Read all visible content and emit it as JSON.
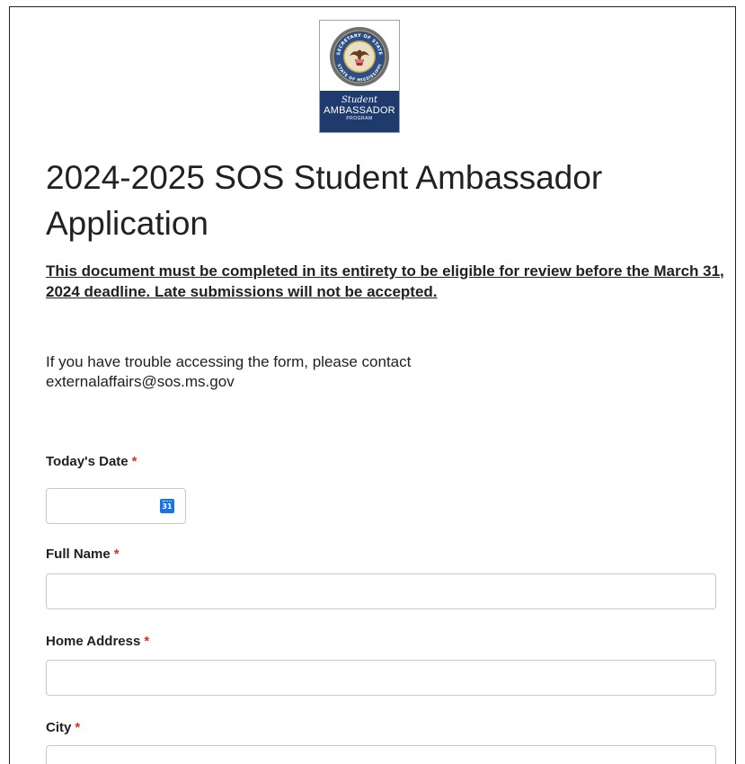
{
  "logo": {
    "banner_line1": "Student",
    "banner_line2": "AMBASSADOR",
    "banner_line3": "PROGRAM",
    "seal_text_top": "SECRETARY OF STATE",
    "seal_text_bottom": "STATE OF MISSISSIPPI"
  },
  "form": {
    "title": "2024-2025 SOS Student Ambassador Application",
    "notice": "This document must be completed in its entirety to be eligible for review before the March 31, 2024 deadline. Late submissions will not be accepted.",
    "contact_line1": "If you have trouble accessing the form, please contact",
    "contact_line2": "externalaffairs@sos.ms.gov",
    "required_marker": "*"
  },
  "fields": {
    "todays_date": {
      "label": "Today's Date",
      "value": ""
    },
    "full_name": {
      "label": "Full Name",
      "value": ""
    },
    "home_address": {
      "label": "Home Address",
      "value": ""
    },
    "city": {
      "label": "City",
      "value": ""
    }
  },
  "icons": {
    "calendar": "calendar-icon",
    "calendar_day": "31"
  },
  "colors": {
    "required": "#d93025",
    "calendar_icon": "#1a73e8",
    "banner": "#1f3b6e",
    "input_border": "#c8c8c8"
  }
}
